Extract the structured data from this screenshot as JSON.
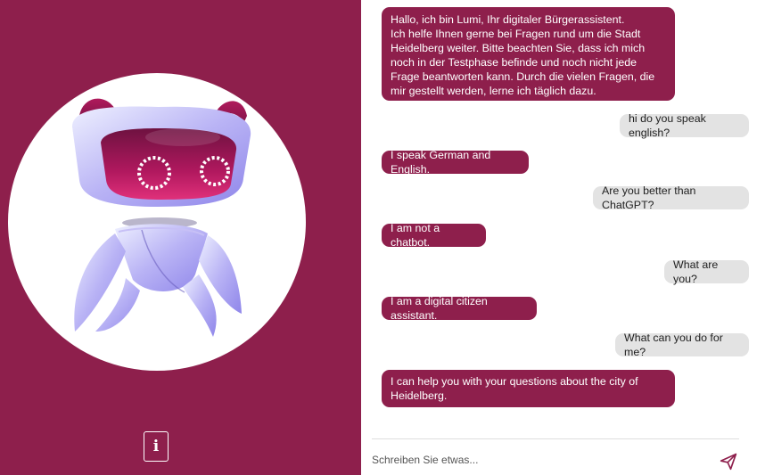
{
  "colors": {
    "brand": "#8e1f4c",
    "user_bubble": "#e3e3e3",
    "background": "#ffffff"
  },
  "sidebar": {
    "avatar_icon": "robot-mascot-icon",
    "info_label": "i",
    "info_icon": "info-icon"
  },
  "chat": {
    "messages": [
      {
        "role": "bot",
        "text": "Hallo, ich bin Lumi, Ihr digitaler Bürgerassistent.\nIch helfe Ihnen gerne bei Fragen rund um die Stadt Heidelberg weiter. Bitte beachten Sie, dass ich mich noch in der Testphase befinde und noch nicht jede Frage beantworten kann. Durch die vielen Fragen, die mir gestellt werden, lerne ich täglich dazu."
      },
      {
        "role": "user",
        "text": "hi do you speak english?"
      },
      {
        "role": "bot",
        "text": "I speak German and English."
      },
      {
        "role": "user",
        "text": "Are you better than ChatGPT?"
      },
      {
        "role": "bot",
        "text": "I am not a chatbot."
      },
      {
        "role": "user",
        "text": "What are you?"
      },
      {
        "role": "bot",
        "text": "I am a digital citizen assistant."
      },
      {
        "role": "user",
        "text": "What can you do for me?"
      },
      {
        "role": "bot",
        "text": "I can help you with your questions about the city of Heidelberg."
      }
    ]
  },
  "composer": {
    "placeholder": "Schreiben Sie etwas...",
    "value": "",
    "send_icon": "send-icon"
  }
}
